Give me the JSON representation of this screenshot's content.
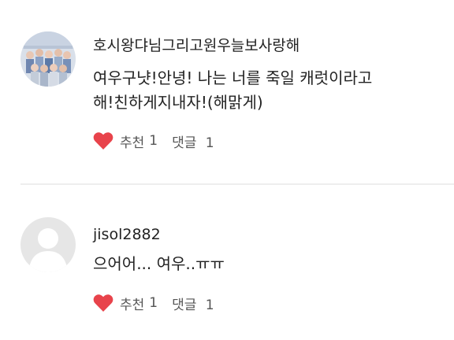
{
  "colors": {
    "heart": "#e8434b",
    "divider": "#eeeeee",
    "text_primary": "#222222",
    "text_secondary": "#555555",
    "avatar_placeholder_bg": "#e6e6e6",
    "avatar_placeholder_fg": "#ffffff"
  },
  "comments": [
    {
      "author": "호시왕댜님그리고원우늘보사랑해",
      "avatar": "group-photo",
      "lines": [
        "여우구냣!안녕! 나는 너를 죽일 캐럿이라고",
        "해!친하게지내자!(해맑게)"
      ],
      "like_icon": "heart-icon",
      "like_label": "추천",
      "like_count": "1",
      "reply_label": "댓글",
      "reply_count": "1"
    },
    {
      "author": "jisol2882",
      "avatar": "default-profile",
      "lines": [
        "으어어... 여우..ㅠㅠ"
      ],
      "like_icon": "heart-icon",
      "like_label": "추천",
      "like_count": "1",
      "reply_label": "댓글",
      "reply_count": "1"
    }
  ]
}
